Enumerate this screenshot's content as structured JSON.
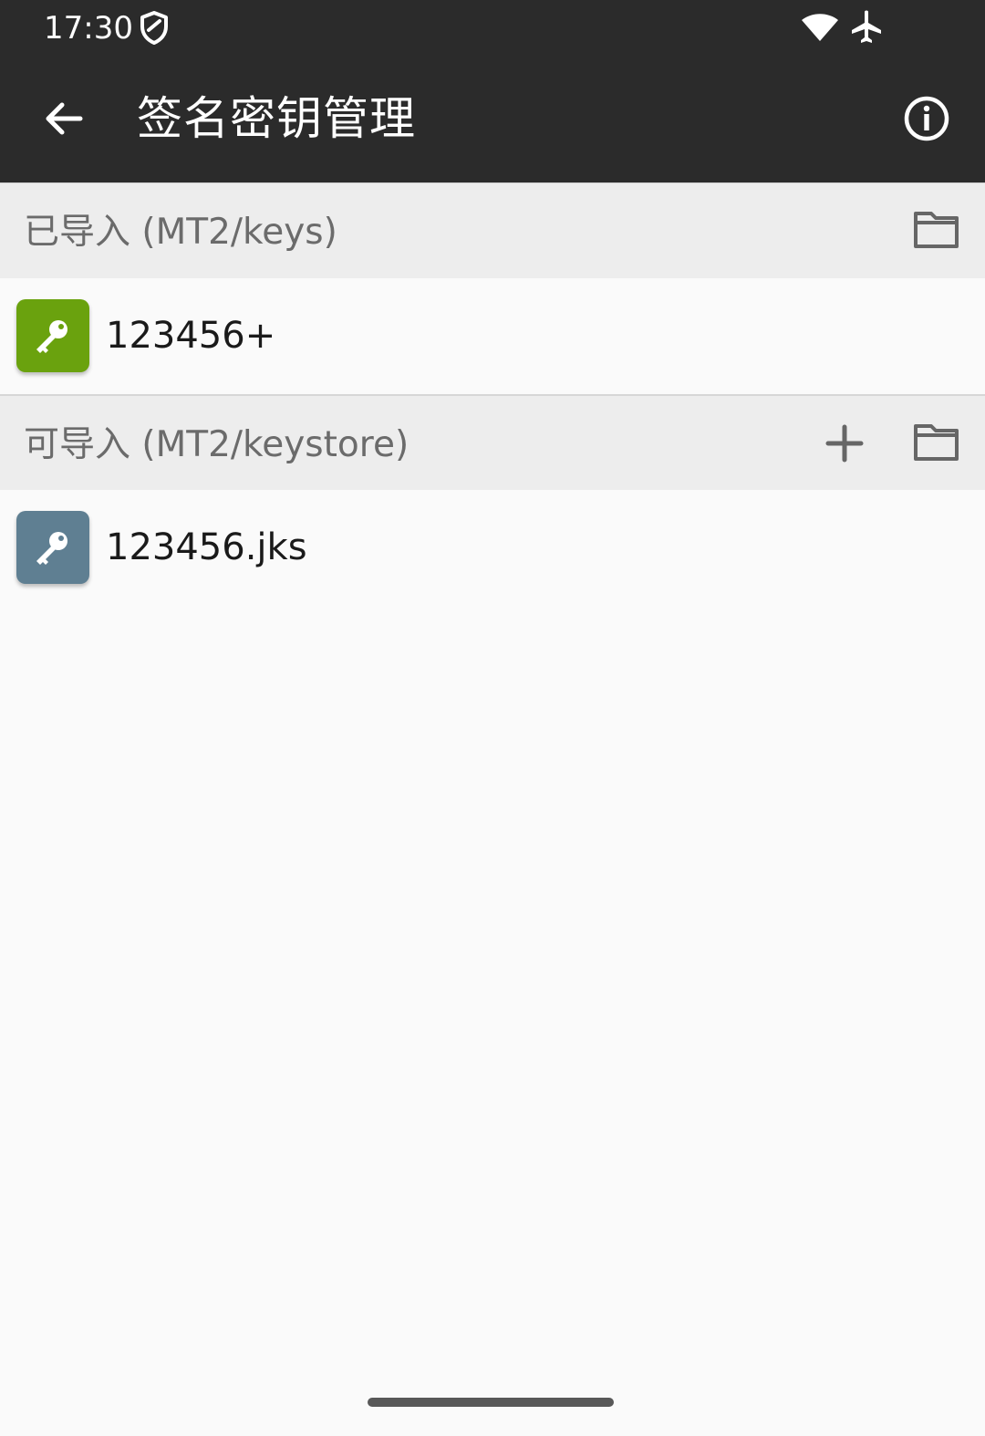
{
  "status_bar": {
    "time": "17:30",
    "icons": [
      "shield-icon",
      "wifi-icon",
      "airplane-mode-icon"
    ]
  },
  "toolbar": {
    "title": "签名密钥管理",
    "back_icon": "arrow-back-icon",
    "info_icon": "info-icon"
  },
  "sections": [
    {
      "header": "已导入 (MT2/keys)",
      "actions": [
        "folder-icon"
      ],
      "items": [
        {
          "label": "123456+",
          "icon": "key-icon",
          "icon_color": "#6aa20e"
        }
      ]
    },
    {
      "header": "可导入 (MT2/keystore)",
      "actions": [
        "add-icon",
        "folder-icon"
      ],
      "items": [
        {
          "label": "123456.jks",
          "icon": "key-icon",
          "icon_color": "#5f7f92"
        }
      ]
    }
  ],
  "colors": {
    "app_bar": "#2b2b2b",
    "section_header_bg": "#ededed",
    "background": "#fafafa"
  }
}
